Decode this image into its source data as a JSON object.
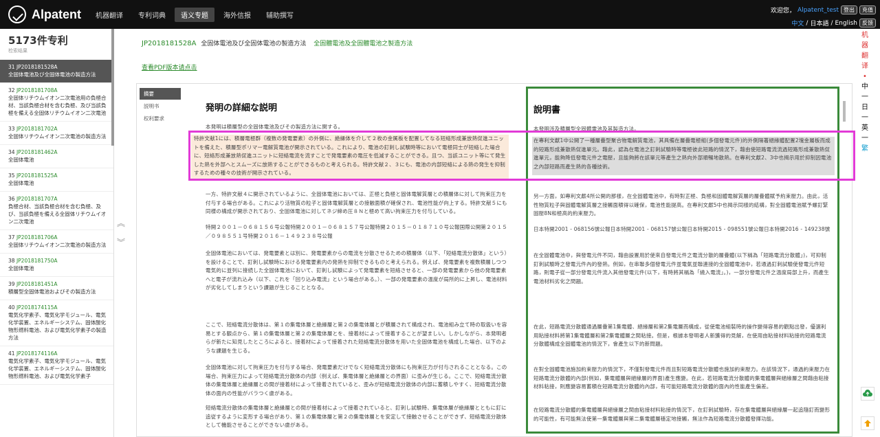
{
  "app": {
    "logo_text": "Alpatent"
  },
  "nav": [
    "机器翻译",
    "专利词典",
    "语义专题",
    "海外信报",
    "辅助撰写"
  ],
  "nav_active_index": 2,
  "user": {
    "greeting": "欢迎您，",
    "name": "Alpatent_test",
    "logout": "登出",
    "recharge": "充值",
    "lang_cn": "中文",
    "lang_ja": "日本語",
    "lang_en": "English",
    "feedback": "反馈"
  },
  "sidebar": {
    "count": "5173件专利",
    "count_sub": "检索结果",
    "items": [
      {
        "num": "31",
        "id": "JP2018181528A",
        "title": "全固体電池及び全固体電池の製造方法"
      },
      {
        "num": "32",
        "id": "JP2018181708A",
        "title": "全固体リチウムイオン二次電池用の負極合材、当該負極合材を含む負極、及び当該負極を備える全固体リチウムイオン二次電池"
      },
      {
        "num": "33",
        "id": "JP2018181702A",
        "title": "全固体リチウムイオン二次電池の製造方法"
      },
      {
        "num": "34",
        "id": "JP2018181462A",
        "title": "全固体電池"
      },
      {
        "num": "35",
        "id": "JP2018181525A",
        "title": "全固体電池"
      },
      {
        "num": "36",
        "id": "JP2018181707A",
        "title": "負極合材、当該負極合材を含む負極、及び、当該負極を備える全固体リチウムイオン二次電池"
      },
      {
        "num": "37",
        "id": "JP2018181706A",
        "title": "全固体リチウムイオン二次電池の製造方法"
      },
      {
        "num": "38",
        "id": "JP2018181750A",
        "title": "全固体電池"
      },
      {
        "num": "39",
        "id": "JP2018181451A",
        "title": "積層型全固体電池およびその製造方法"
      },
      {
        "num": "40",
        "id": "JP2018174115A",
        "title": "電気化学素子、電気化学モジュール、電気化学装置、エネルギーシステム、固体酸化物形燃料電池、および電気化学素子の製造方法"
      },
      {
        "num": "41",
        "id": "JP2018174116A",
        "title": "電気化学素子、電気化学モジュール、電気化学装置、エネルギーシステム、固体酸化物形燃料電池、および電気化学素子"
      }
    ]
  },
  "doc": {
    "id": "JP2018181528A",
    "title_ja": "全固体電池及び全固体電池の製造方法",
    "title_cn": "全固體電池及全固體電池之製造方法",
    "pdf_link": "查看PDF版本请点击",
    "tabs": [
      "摘要",
      "説明书",
      "权利要求"
    ],
    "ja_title": "発明の詳細な説明",
    "cn_title": "說明書",
    "ja_paras": [
      "本発明は積層型の全固体電池及びその製造方法に関する。",
      "特許文献1には、積層電極群（複数の発電要素）の外側に、絶縁体を介して２枚の金属板を配置してなる短絡形成兼放熱促進ユニットを備えた、積層型ポリマー電解質電池が開示されている。これにより、電池の釘刺し試験時等において電極同士が短絡した場合に、短絡形成兼放熱促進ユニットに短絡電流を流すことで発電要素の電圧を低減することができる。且つ、当該ユニット等にて発生した熱を外部へとスムーズに放熱することができるものと考えられる。特許文献２、３にも、電池の内部短絡による熱の発生を抑制するための種々の技術が開示されている。",
      "一方、特許文献４に開示されているように、全固体電池においては、正極と負極と固体電解質層との積層体に対して拘束圧力を付与する場合がある。これにより活物質の粒子と固体電解質層との接触面積が確保され、電池性能が向上する。特許文献５にも同様の構成が開示されており、全固体電池に対してネジ締め圧８Ｎと極めて高い拘束圧力を付与している。",
      "特開２００１－０６８１５６号公報特開２００１－０６８１５７号公報特開２０１５－０１８７１０号公報国際公開第２０１５／０９８５５１号特開２０１６－１４９２３８号公報",
      "全固体電池においては、発電要素とは別に、発電要素からの電流を分散させるための積層体（以下、「短絡電流分散体」という）を設けることで、釘刺し試験時における発電要素内の発熱を抑制できるものと考えられる。例えば、発電要素を複数積層しつつ電気的に並列に接続した全固体電池において、釘刺し試験によって発電要素を短絡させると、一部の発電要素から他の発電要素へと電子が流れ込み（以下、これを「回り込み電流」という場合がある。）、一部の発電要素の温度が局所的に上昇し、電池材料が劣化してしまうという課題が生じることとなる。",
      "ここで、短絡電流分散体は、第１の集電体層と絶縁層と第２の集電体層とが積層されて構成され、電池組み立て時の取扱いを容易とする観点から、第１の集電体層と第２の集電体層とを、接着材によって接着することが望ましい。しかしながら、本発明者らが新たに知見したところによると、接着材によって接着された短絡電流分散体を用いた全固体電池を構成した場合、以下のような課題を生じる。",
      "全固体電池に対して拘束圧力を付与する場合、発電要素だけでなく短絡電流分散体にも拘束圧力が付与されることとなる。この場合、拘束圧力によって短絡電流分散体の内部（例えば、集電体層と絶縁層との界面）に歪みが生じる。ここで、短絡電流分散体の集電体層と絶縁層との間が接着材によって接着されていると、歪みが短絡電流分散体の内部に蓄積しやすく、短絡電流分散体の面内の性能がバラつく虞がある。",
      "短絡電流分散体の集電体層と絶縁層との間が接着材によって接着されていると、釘刺し試験時、集電体層が絶縁層とともに釘に追従するように変形する場合があり、第１の集電体層と第２の集電体層とを安定して接触させることができず、短絡電流分散体として機能させることができない虞がある。"
    ],
    "cn_paras": [
      "本發明涉及積層型全固體電池及其製造方法。",
      "在專利文獻1中公開了一種層疊型聚合物電解質電池，其具備在層疊電極組(多個發電元件)的外側隔著絕緣體配置2塊金屬板而成的短路形成兼散熱促進單元。藉此，認為在電池之釘刺試驗時等電極彼此短路的情況下，藉由使短路電流流過短路形成兼散熱促進單元，能夠降低發電元件之電壓，且能夠將在該單元等產生之熱向外部順暢地散熱。在專利文獻2、3中也揭示用於抑制因電池之內部短路而產生熱的各種技術。",
      "另一方面，如專利文獻4所公開的那樣，在全固體電池中，有時對正極、負極和固體電解質層的層疊體賦予約束壓力。由此，活性物質粒子與固體電解質層之接觸面積得以確保，電池性能提高。在專利文獻5中也揭示同樣的結構，對全固體電池賦予螺釘緊固壓8N和極高的約束壓力。",
      "日本特開2001 - 068156號公報日本特開2001 - 068157號公報日本特開2015 - 098551號公報日本特開2016 - 149238號公報",
      "在全固體電池中，與發電元件不同，藉由設置用於使來自發電元件之電流分散的層疊體(以下稱為「短路電流分散體」)，可抑制釘刺試驗時之發電元件內的發熱。例如，在串聯多個發電元件並電氣並聯連接的全固體電池中，若通過釘刺試驗使發電元件短路，則電子從一部分發電元件流入其他發電元件(以下，有時將其稱為「繞入電流」。)，一部分發電元件之溫度局部上升，而產生電池材料劣化之問題。",
      "在此，短路電流分散體通過層疊第1集電體、絕緣層和第2集電層而構成，從使電池組裝時的操作變得容易的觀點出發，優選利用粘接材料將第1集電體層和第2集電體層之間粘接。但是，根據本發明者人新獲得的見解，在使用由粘接材料粘接的短路電流分散體構成全固體電池的情況下，會產生以下的新問題。",
      "在對全固體電池施加約束壓力的情況下，不僅對發電元件而且對短路電流分散體也施加約束壓力。在該情況下，通過約束壓力在短路電流分散體的內部(例如，集電體層與絕緣層的界面)產生應變。在此，若短路電流分散體的集電體層與絕緣層之間藉由粘接材料粘接，則應變容易蓄積在短路電流分散體的內部，有可能短路電流分散體的面內的性能產生偏差。",
      "在短路電流分散體的集電體層與絕緣層之間由粘接材料粘接的情況下，在釘刺試驗時，存在集電體層與絕緣層一起追隨釘而變形的可能性，有可能無法使第一集電體層與第二集電體層穩定地接觸，無法作為短路電流分散體發揮功能。"
    ]
  },
  "right_vertical": [
    "机",
    "器",
    "翻",
    "译",
    "•",
    "中",
    "一",
    "日",
    "一",
    "英",
    "一",
    "繁"
  ],
  "icons": {
    "cloud": "cloud-upload-icon",
    "top": "back-to-top-icon"
  },
  "colors": {
    "accent_green": "#2a8a2a",
    "highlight_magenta": "#e23ad7",
    "frame_green": "#3a8a3a"
  }
}
